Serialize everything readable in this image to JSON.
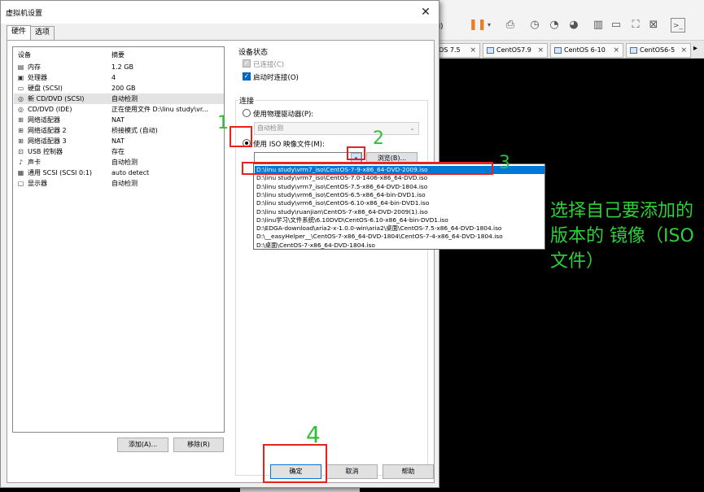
{
  "background_app": {
    "toolbar_fragment": "动(M)",
    "tabs": [
      "OS 7.5",
      "CentOS7.9",
      "CentOS 6-10",
      "CentOS6-5"
    ]
  },
  "dialog": {
    "title": "虚拟机设置",
    "tabs": [
      "硬件",
      "选项"
    ],
    "list_headers": {
      "device": "设备",
      "summary": "摘要"
    },
    "devices": [
      {
        "icon": "memory-icon",
        "name": "内存",
        "summary": "1.2 GB"
      },
      {
        "icon": "cpu-icon",
        "name": "处理器",
        "summary": "4"
      },
      {
        "icon": "disk-icon",
        "name": "硬盘 (SCSI)",
        "summary": "200 GB"
      },
      {
        "icon": "cd-icon",
        "name": "新 CD/DVD (SCSI)",
        "summary": "自动检测"
      },
      {
        "icon": "cd-icon",
        "name": "CD/DVD (IDE)",
        "summary": "正在使用文件 D:\\linu study\\vr..."
      },
      {
        "icon": "network-icon",
        "name": "网络适配器",
        "summary": "NAT"
      },
      {
        "icon": "network-icon",
        "name": "网络适配器 2",
        "summary": "桥接模式 (自动)"
      },
      {
        "icon": "network-icon",
        "name": "网络适配器 3",
        "summary": "NAT"
      },
      {
        "icon": "usb-icon",
        "name": "USB 控制器",
        "summary": "存在"
      },
      {
        "icon": "sound-icon",
        "name": "声卡",
        "summary": "自动检测"
      },
      {
        "icon": "scsi-icon",
        "name": "通用 SCSI (SCSI 0:1)",
        "summary": "auto detect"
      },
      {
        "icon": "display-icon",
        "name": "显示器",
        "summary": "自动检测"
      }
    ],
    "selected_device_index": 3,
    "add_button": "添加(A)...",
    "remove_button": "移除(R)",
    "device_status": {
      "title": "设备状态",
      "connected": "已连接(C)",
      "connect_at_power_on": "启动时连接(O)"
    },
    "connection": {
      "title": "连接",
      "physical_drive": "使用物理驱动器(P):",
      "physical_drive_value": "自动检测",
      "use_iso": "使用 ISO 映像文件(M):",
      "browse": "浏览(B)..."
    },
    "iso_dropdown": [
      "D:\\linu study\\vrm7_iso\\CentOS-7-9-x86_64-DVD-2009.iso",
      "D:\\linu study\\vrm7_iso\\CentOS-7.0-1406-x86_64-DVD.iso",
      "D:\\linu study\\vrm7_iso\\CentOS-7.5-x86_64-DVD-1804.iso",
      "D:\\linu study\\vrm6_iso\\CentOS-6.5-x86_64-bin-DVD1.iso",
      "D:\\linu study\\vrm6_iso\\CentOS-6.10-x86_64-bin-DVD1.iso",
      "D:\\linu study\\ruanjian\\CentOS-7-x86_64-DVD-2009(1).iso",
      "D:\\linu学习\\文件系统\\6.10DVD\\CentOS-6.10-x86_64-bin-DVD1.iso",
      "D:\\EDGA-download\\aria2-x-1.0.0-win\\aria2\\桌面\\CentOS-7.5-x86_64-DVD-1804.iso",
      "D:\\__easyHelper__\\CentOS-7-x86_64-DVD-1804\\CentOS-7-4-x86_64-DVD-1804.iso",
      "D:\\桌面\\CentOS-7-x86_64-DVD-1804.iso"
    ],
    "iso_selected_index": 0,
    "footer": {
      "ok": "确定",
      "cancel": "取消",
      "help": "帮助"
    }
  },
  "annotations": {
    "step1": "1",
    "step2": "2",
    "step3": "3",
    "step4": "4",
    "caption": "选择自己要添加的版本的 镜像（ISO文件）",
    "color_box": "#e8211d",
    "color_text": "#2fcf3a"
  }
}
